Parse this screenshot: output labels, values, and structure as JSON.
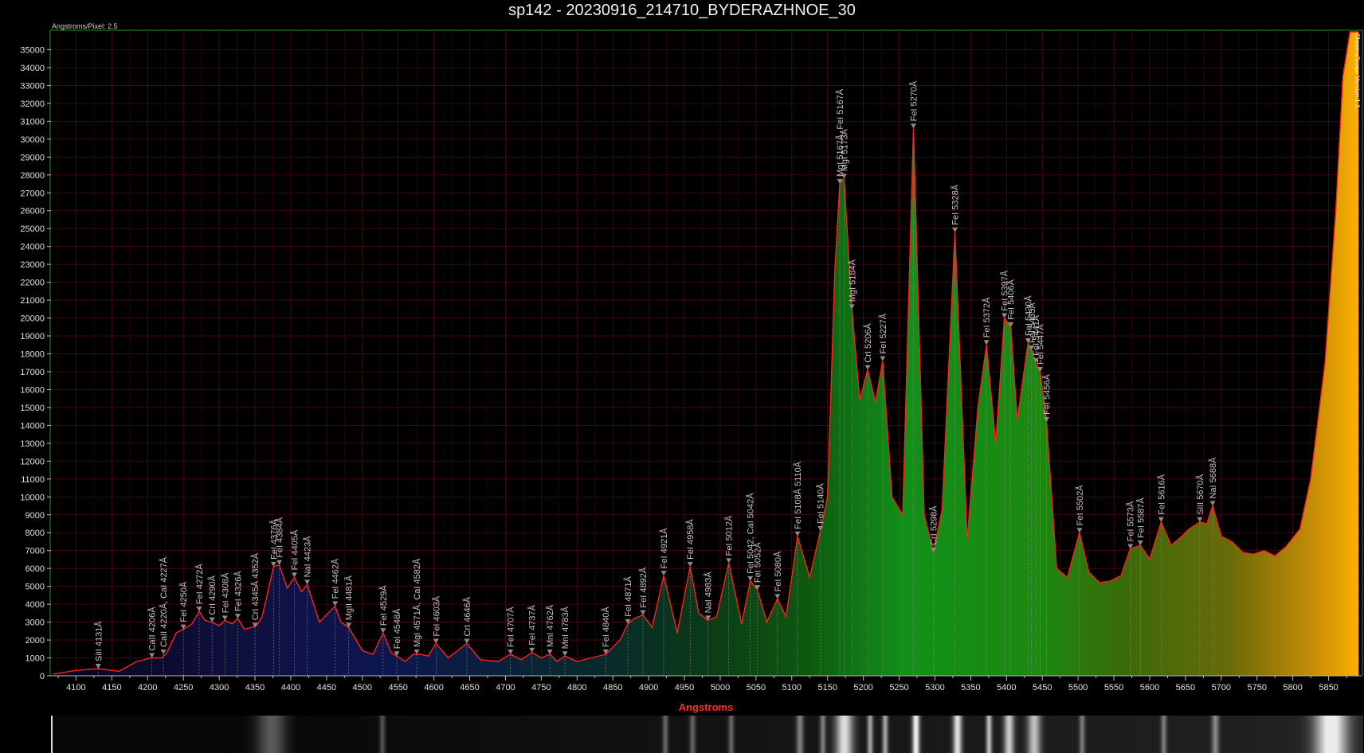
{
  "window": {
    "title": "sp142 - 20230916_214710_BYDERAZHNOE_30",
    "scale_note": "Angstroms/Pixel: 2.5",
    "version_badge": "ChromaScope Version 1.1"
  },
  "colors": {
    "curve": "#ff2020",
    "grid": "#5a0a0a",
    "axis_title": "#ff2a2a"
  },
  "chart_data": {
    "type": "area",
    "title": "sp142 - 20230916_214710_BYDERAZHNOE_30",
    "xlabel": "Angstroms",
    "ylabel": "",
    "xlim": [
      4065,
      5895
    ],
    "ylim": [
      0,
      36000
    ],
    "grid": true,
    "legend": "none",
    "x_ticks": [
      4100,
      4150,
      4200,
      4250,
      4300,
      4350,
      4400,
      4450,
      4500,
      4550,
      4600,
      4650,
      4700,
      4750,
      4800,
      4850,
      4900,
      4950,
      5000,
      5050,
      5100,
      5150,
      5200,
      5250,
      5300,
      5350,
      5400,
      5450,
      5500,
      5550,
      5600,
      5650,
      5700,
      5750,
      5800,
      5850
    ],
    "y_ticks": [
      0,
      1000,
      2000,
      3000,
      4000,
      5000,
      6000,
      7000,
      8000,
      9000,
      10000,
      11000,
      12000,
      13000,
      14000,
      15000,
      16000,
      17000,
      18000,
      19000,
      20000,
      21000,
      22000,
      23000,
      24000,
      25000,
      26000,
      27000,
      28000,
      29000,
      30000,
      31000,
      32000,
      33000,
      34000,
      35000
    ],
    "series": [
      {
        "x": [
          4068,
          4100,
          4131,
          4160,
          4185,
          4206,
          4220,
          4227,
          4240,
          4250,
          4262,
          4272,
          4280,
          4290,
          4300,
          4308,
          4318,
          4326,
          4335,
          4345,
          4352,
          4360,
          4376,
          4384,
          4395,
          4405,
          4415,
          4423,
          4440,
          4462,
          4470,
          4481,
          4500,
          4515,
          4529,
          4540,
          4548,
          4560,
          4571,
          4582,
          4592,
          4603,
          4620,
          4646,
          4665,
          4690,
          4707,
          4722,
          4737,
          4750,
          4762,
          4772,
          4783,
          4800,
          4820,
          4840,
          4860,
          4871,
          4880,
          4892,
          4905,
          4921,
          4940,
          4958,
          4970,
          4983,
          4995,
          5012,
          5030,
          5042,
          5052,
          5065,
          5080,
          5092,
          5100,
          5108,
          5125,
          5140,
          5150,
          5160,
          5167,
          5173,
          5184,
          5195,
          5206,
          5217,
          5227,
          5240,
          5255,
          5270,
          5285,
          5298,
          5310,
          5328,
          5345,
          5360,
          5372,
          5385,
          5397,
          5406,
          5415,
          5430,
          5435,
          5441,
          5447,
          5456,
          5470,
          5485,
          5502,
          5515,
          5530,
          5545,
          5560,
          5573,
          5587,
          5600,
          5616,
          5630,
          5645,
          5655,
          5670,
          5680,
          5688,
          5700,
          5715,
          5730,
          5745,
          5760,
          5775,
          5790,
          5810,
          5825,
          5845,
          5860,
          5870,
          5880,
          5892
        ],
        "y": [
          100,
          300,
          400,
          250,
          800,
          1000,
          1000,
          1300,
          2400,
          2600,
          2900,
          3600,
          3100,
          3000,
          2800,
          3100,
          2900,
          3200,
          2600,
          2700,
          2800,
          3300,
          6100,
          6200,
          4900,
          5500,
          4700,
          5100,
          3000,
          3900,
          3000,
          2700,
          1400,
          1200,
          2400,
          1300,
          1100,
          800,
          1200,
          1200,
          1100,
          1800,
          1000,
          1800,
          900,
          800,
          1200,
          900,
          1300,
          1000,
          1200,
          800,
          1100,
          800,
          1000,
          1200,
          2000,
          2900,
          3200,
          3400,
          2700,
          5600,
          2400,
          6100,
          3500,
          3100,
          3300,
          6300,
          2900,
          5300,
          4800,
          3000,
          4300,
          3300,
          5500,
          7800,
          5500,
          8100,
          10000,
          22500,
          27500,
          27800,
          20500,
          15400,
          17100,
          15300,
          17600,
          10000,
          9000,
          30600,
          9000,
          6900,
          9300,
          24800,
          7600,
          15000,
          18500,
          13000,
          20000,
          19500,
          14300,
          18600,
          18200,
          17500,
          17000,
          14200,
          6000,
          5500,
          8000,
          5800,
          5200,
          5300,
          5600,
          7100,
          7300,
          6500,
          8600,
          7300,
          7800,
          8200,
          8600,
          8500,
          9500,
          7800,
          7500,
          6900,
          6800,
          7000,
          6700,
          7200,
          8200,
          11000,
          17500,
          26000,
          33500,
          36000,
          36000
        ]
      }
    ],
    "annotations": [
      {
        "x": 4131,
        "y": 400,
        "label": "SiII 4131Å"
      },
      {
        "x": 4206,
        "y": 1000,
        "label": "CaII 4206Å"
      },
      {
        "x": 4222,
        "y": 1200,
        "label": "CaII 4220Å, CaI 4227Å"
      },
      {
        "x": 4250,
        "y": 2600,
        "label": "FeI 4250Å"
      },
      {
        "x": 4272,
        "y": 3600,
        "label": "FeI 4272Å"
      },
      {
        "x": 4290,
        "y": 3000,
        "label": "CrI 4290Å"
      },
      {
        "x": 4308,
        "y": 3100,
        "label": "FeI 4308Å"
      },
      {
        "x": 4326,
        "y": 3200,
        "label": "FeI 4326Å"
      },
      {
        "x": 4350,
        "y": 2700,
        "label": "CrI 4345Å 4352Å"
      },
      {
        "x": 4376,
        "y": 6100,
        "label": "FeI 4376Å"
      },
      {
        "x": 4384,
        "y": 6200,
        "label": "FeI 4384Å"
      },
      {
        "x": 4405,
        "y": 5500,
        "label": "FeI 4405Å"
      },
      {
        "x": 4423,
        "y": 5100,
        "label": "NaI 4423Å"
      },
      {
        "x": 4462,
        "y": 3900,
        "label": "FeI 4462Å"
      },
      {
        "x": 4481,
        "y": 2700,
        "label": "MgII 4481Å"
      },
      {
        "x": 4529,
        "y": 2400,
        "label": "FeI 4529Å"
      },
      {
        "x": 4548,
        "y": 1100,
        "label": "FeI 4548Å"
      },
      {
        "x": 4576,
        "y": 1200,
        "label": "MgI 4571Å, CaI 4582Å"
      },
      {
        "x": 4603,
        "y": 1800,
        "label": "FeI 4603Å"
      },
      {
        "x": 4646,
        "y": 1800,
        "label": "CrI 4646Å"
      },
      {
        "x": 4707,
        "y": 1200,
        "label": "FeI 4707Å"
      },
      {
        "x": 4737,
        "y": 1300,
        "label": "FeI 4737Å"
      },
      {
        "x": 4762,
        "y": 1200,
        "label": "MnI 4762Å"
      },
      {
        "x": 4783,
        "y": 1100,
        "label": "MnI 4783Å"
      },
      {
        "x": 4840,
        "y": 1200,
        "label": "FeI 4840Å"
      },
      {
        "x": 4871,
        "y": 2900,
        "label": "FeI 4871Å"
      },
      {
        "x": 4892,
        "y": 3400,
        "label": "FeI 4892Å"
      },
      {
        "x": 4921,
        "y": 5600,
        "label": "FeI 4921Å"
      },
      {
        "x": 4958,
        "y": 6100,
        "label": "FeI 4958Å"
      },
      {
        "x": 4983,
        "y": 3100,
        "label": "NaI 4983Å"
      },
      {
        "x": 5012,
        "y": 6300,
        "label": "FeI 5012Å"
      },
      {
        "x": 5042,
        "y": 5300,
        "label": "FeI 5042, CaI 5042Å"
      },
      {
        "x": 5052,
        "y": 4800,
        "label": "FeI 5052Å"
      },
      {
        "x": 5080,
        "y": 4300,
        "label": "FeI 5080Å"
      },
      {
        "x": 5108,
        "y": 7800,
        "label": "FeI 5108Å 5110Å"
      },
      {
        "x": 5140,
        "y": 8100,
        "label": "FeI 5140Å"
      },
      {
        "x": 5167,
        "y": 27500,
        "label": "MgI 5167Å, FeI 5167Å"
      },
      {
        "x": 5173,
        "y": 27800,
        "label": "MgI 5173Å"
      },
      {
        "x": 5184,
        "y": 20500,
        "label": "MgI 5184Å"
      },
      {
        "x": 5206,
        "y": 17100,
        "label": "CrI 5206Å"
      },
      {
        "x": 5227,
        "y": 17600,
        "label": "FeI 5227Å"
      },
      {
        "x": 5270,
        "y": 30600,
        "label": "FeI 5270Å"
      },
      {
        "x": 5298,
        "y": 6900,
        "label": "CrI 5298Å"
      },
      {
        "x": 5328,
        "y": 24800,
        "label": "FeI 5328Å"
      },
      {
        "x": 5372,
        "y": 18500,
        "label": "FeI 5372Å"
      },
      {
        "x": 5397,
        "y": 20000,
        "label": "FeI 5397Å"
      },
      {
        "x": 5406,
        "y": 19500,
        "label": "FeI 5406Å"
      },
      {
        "x": 5430,
        "y": 18600,
        "label": "FeI 5430Å"
      },
      {
        "x": 5435,
        "y": 18200,
        "label": "FeI 5435Å"
      },
      {
        "x": 5441,
        "y": 17500,
        "label": "FeI 5441Å"
      },
      {
        "x": 5447,
        "y": 17000,
        "label": "FeI 5447Å"
      },
      {
        "x": 5456,
        "y": 14200,
        "label": "FeI 5456Å"
      },
      {
        "x": 5502,
        "y": 8000,
        "label": "FeI 5502Å"
      },
      {
        "x": 5573,
        "y": 7100,
        "label": "FeI 5573Å"
      },
      {
        "x": 5587,
        "y": 7300,
        "label": "FeI 5587Å"
      },
      {
        "x": 5616,
        "y": 8600,
        "label": "FeI 5616Å"
      },
      {
        "x": 5670,
        "y": 8600,
        "label": "SiII 5670Å"
      },
      {
        "x": 5688,
        "y": 9500,
        "label": "NaI 5688Å"
      }
    ],
    "spectrum_strip_bands": [
      {
        "x": 4370,
        "w": 40,
        "i": 0.35
      },
      {
        "x": 4525,
        "w": 8,
        "i": 0.3
      },
      {
        "x": 4920,
        "w": 8,
        "i": 0.35
      },
      {
        "x": 4958,
        "w": 8,
        "i": 0.35
      },
      {
        "x": 5012,
        "w": 8,
        "i": 0.35
      },
      {
        "x": 5108,
        "w": 10,
        "i": 0.45
      },
      {
        "x": 5140,
        "w": 8,
        "i": 0.45
      },
      {
        "x": 5170,
        "w": 24,
        "i": 0.85
      },
      {
        "x": 5206,
        "w": 8,
        "i": 0.6
      },
      {
        "x": 5227,
        "w": 8,
        "i": 0.6
      },
      {
        "x": 5270,
        "w": 10,
        "i": 0.95
      },
      {
        "x": 5328,
        "w": 12,
        "i": 0.85
      },
      {
        "x": 5372,
        "w": 8,
        "i": 0.7
      },
      {
        "x": 5400,
        "w": 14,
        "i": 0.75
      },
      {
        "x": 5435,
        "w": 18,
        "i": 0.7
      },
      {
        "x": 5502,
        "w": 8,
        "i": 0.4
      },
      {
        "x": 5616,
        "w": 8,
        "i": 0.4
      },
      {
        "x": 5688,
        "w": 10,
        "i": 0.45
      },
      {
        "x": 5850,
        "w": 45,
        "i": 0.95
      }
    ]
  }
}
